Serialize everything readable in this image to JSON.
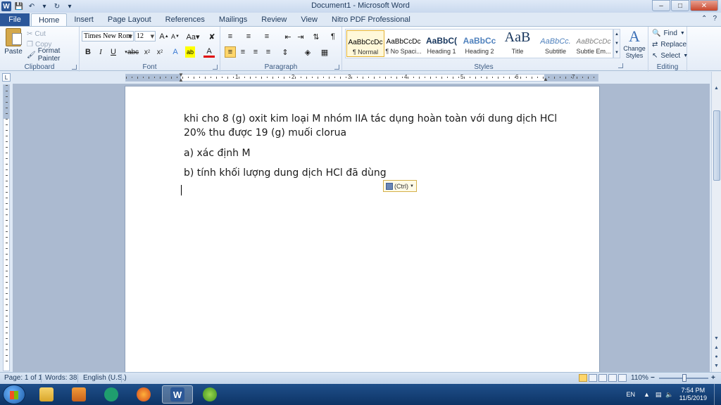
{
  "window": {
    "title": "Document1 - Microsoft Word",
    "min_label": "–",
    "max_label": "□",
    "close_label": "✕"
  },
  "tabs": {
    "file": "File",
    "items": [
      "Home",
      "Insert",
      "Page Layout",
      "References",
      "Mailings",
      "Review",
      "View",
      "Nitro PDF Professional"
    ]
  },
  "ribbon": {
    "clipboard": {
      "label": "Clipboard",
      "paste": "Paste",
      "cut": "Cut",
      "copy": "Copy",
      "format_painter": "Format Painter"
    },
    "font": {
      "label": "Font",
      "font_name": "Times New Rom",
      "font_size": "12"
    },
    "paragraph": {
      "label": "Paragraph"
    },
    "styles": {
      "label": "Styles",
      "items": [
        {
          "sample": "AaBbCcDc",
          "name": "¶ Normal"
        },
        {
          "sample": "AaBbCcDc",
          "name": "¶ No Spaci..."
        },
        {
          "sample": "AaBbC(",
          "name": "Heading 1"
        },
        {
          "sample": "AaBbCc",
          "name": "Heading 2"
        },
        {
          "sample": "AaB",
          "name": "Title"
        },
        {
          "sample": "AaBbCc.",
          "name": "Subtitle"
        },
        {
          "sample": "AaBbCcDc",
          "name": "Subtle Em..."
        }
      ],
      "change_styles_1": "Change",
      "change_styles_2": "Styles"
    },
    "editing": {
      "label": "Editing",
      "find": "Find",
      "replace": "Replace",
      "select": "Select"
    }
  },
  "document": {
    "line1": "khi cho 8 (g) oxit kim loại M nhóm IIA tác dụng hoàn toàn với dung dịch HCl",
    "line2": "20% thu được 19 (g) muối clorua",
    "line3": "a) xác định M",
    "line4": "b) tính khối lượng dung dịch HCl đã dùng",
    "paste_options": "(Ctrl)"
  },
  "ruler": {
    "numbers": [
      "1",
      "2",
      "3",
      "4",
      "5",
      "6",
      "7"
    ]
  },
  "status": {
    "page": "Page: 1 of 1",
    "words": "Words: 38",
    "language": "English (U.S.)",
    "zoom": "110%"
  },
  "taskbar": {
    "lang": "EN",
    "time": "7:54 PM",
    "date": "11/5/2019"
  },
  "colors": {
    "file_tab": "#2b579a",
    "taskbar": "#1f4f8a"
  }
}
